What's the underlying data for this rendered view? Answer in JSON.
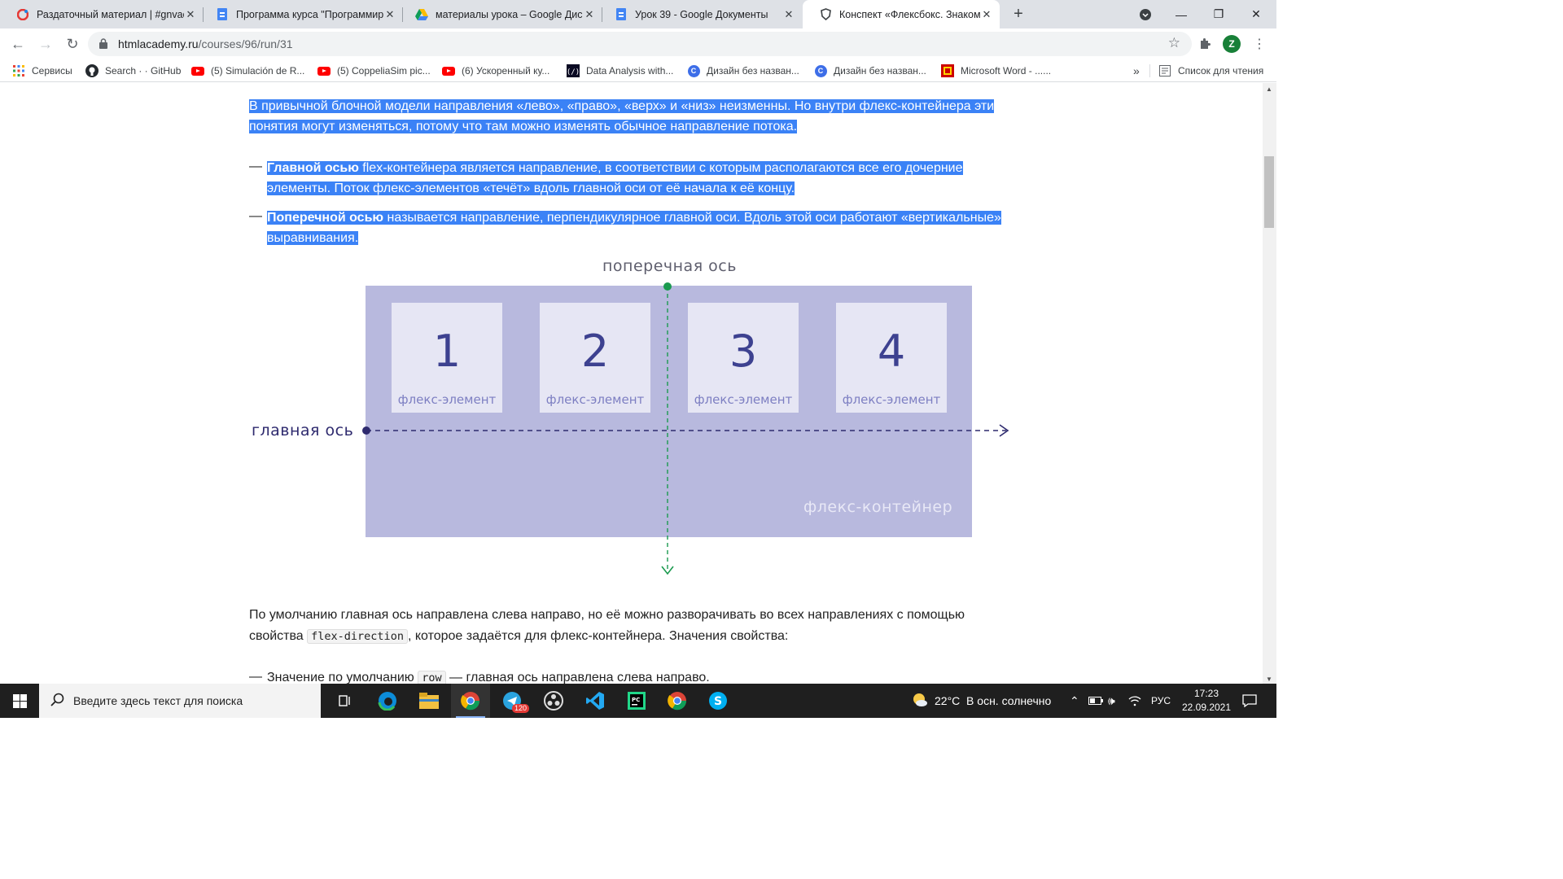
{
  "tabs": [
    {
      "title": "Раздаточный материал | #gnvac",
      "icon": "red-favicon-icon",
      "active": false
    },
    {
      "title": "Программа курса \"Программир",
      "icon": "google-docs-icon",
      "active": false
    },
    {
      "title": "материалы урока – Google Дис",
      "icon": "google-drive-icon",
      "active": false
    },
    {
      "title": "Урок 39 - Google Документы",
      "icon": "google-docs-icon",
      "active": false
    },
    {
      "title": "Конспект «Флексбокс. Знакомст",
      "icon": "htmlacademy-shield-icon",
      "active": true
    }
  ],
  "toolbar": {
    "url_host": "htmlacademy.ru",
    "url_path": "/courses/96/run/31",
    "avatar_letter": "Z"
  },
  "bookmarks": {
    "items": [
      {
        "label": "Сервисы",
        "icon": "apps-grid-icon"
      },
      {
        "label": "Search · · GitHub",
        "icon": "github-icon"
      },
      {
        "label": "(5) Simulación de R...",
        "icon": "youtube-icon"
      },
      {
        "label": "(5) CoppeliaSim pic...",
        "icon": "youtube-icon"
      },
      {
        "label": "(6) Ускоренный ку...",
        "icon": "youtube-icon"
      },
      {
        "label": "Data Analysis with...",
        "icon": "freecodecamp-icon"
      },
      {
        "label": "Дизайн без назван...",
        "icon": "canva-icon"
      },
      {
        "label": "Дизайн без назван...",
        "icon": "canva-icon"
      },
      {
        "label": "Microsoft Word - ......",
        "icon": "pdf-icon"
      }
    ],
    "more": "»",
    "reading_list": "Список для чтения"
  },
  "article": {
    "intro_line1": "В привычной блочной модели направления «лево», «право», «верх» и «низ» неизменны. Но внутри флекс-контейнера эти",
    "intro_line2": "понятия могут изменяться, потому что там можно изменять обычное направление потока.",
    "bullet1_bold": "Главной осью",
    "bullet1_line1_rest": " flex-контейнера является направление, в соответствии с которым располагаются все его дочерние",
    "bullet1_line2": "элементы. Поток флекс-элементов «течёт» вдоль главной оси от её начала к её концу.",
    "bullet2_bold": "Поперечной осью",
    "bullet2_line1_rest": " называется направление, перпендикулярное главной оси. Вдоль этой оси работают «вертикальные»",
    "bullet2_line2": "выравнивания.",
    "dash": "—",
    "para2_line1": "По умолчанию главная ось направлена слева направо, но её можно разворачивать во всех направлениях с помощью",
    "para2_line2_pre": "свойства ",
    "para2_code": "flex-direction",
    "para2_line2_post": ", которое задаётся для флекс-контейнера. Значения свойства:",
    "bullet3_pre": "Значение по умолчанию ",
    "bullet3_code": "row",
    "bullet3_post": " — главная ось направлена слева направо."
  },
  "diagram": {
    "cross_axis_label": "поперечная ось",
    "main_axis_label": "главная ось",
    "container_label": "флекс-контейнер",
    "items": [
      {
        "number": "1",
        "label": "флекс-элемент"
      },
      {
        "number": "2",
        "label": "флекс-элемент"
      },
      {
        "number": "3",
        "label": "флекс-элемент"
      },
      {
        "number": "4",
        "label": "флекс-элемент"
      }
    ],
    "colors": {
      "container": "#b8b9de",
      "item": "#e6e6f4",
      "main_axis": "#2e2a6e",
      "cross_axis": "#1b9a4f"
    }
  },
  "taskbar": {
    "search_placeholder": "Введите здесь текст для поиска",
    "weather": "22°C  В осн. солнечно",
    "language": "РУС",
    "time": "17:23",
    "date": "22.09.2021",
    "telegram_badge": "120"
  }
}
